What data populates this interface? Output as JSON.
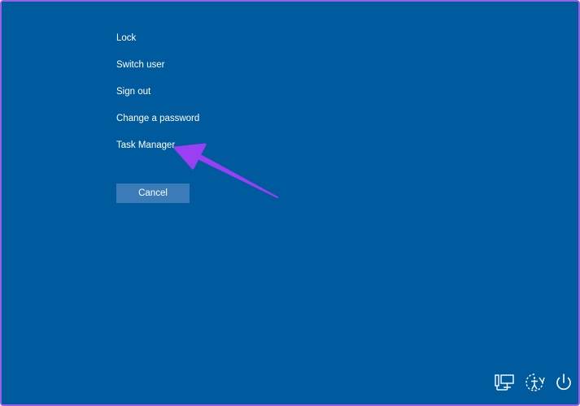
{
  "menu": {
    "items": [
      {
        "label": "Lock"
      },
      {
        "label": "Switch user"
      },
      {
        "label": "Sign out"
      },
      {
        "label": "Change a password"
      },
      {
        "label": "Task Manager"
      }
    ]
  },
  "cancel_label": "Cancel",
  "system_icons": [
    "network-icon",
    "accessibility-icon",
    "power-icon"
  ],
  "colors": {
    "background": "#005a9e",
    "cancel_button": "#3a7bb8",
    "annotation_arrow": "#9b3ff5",
    "frame_border": "#9b5de5"
  }
}
